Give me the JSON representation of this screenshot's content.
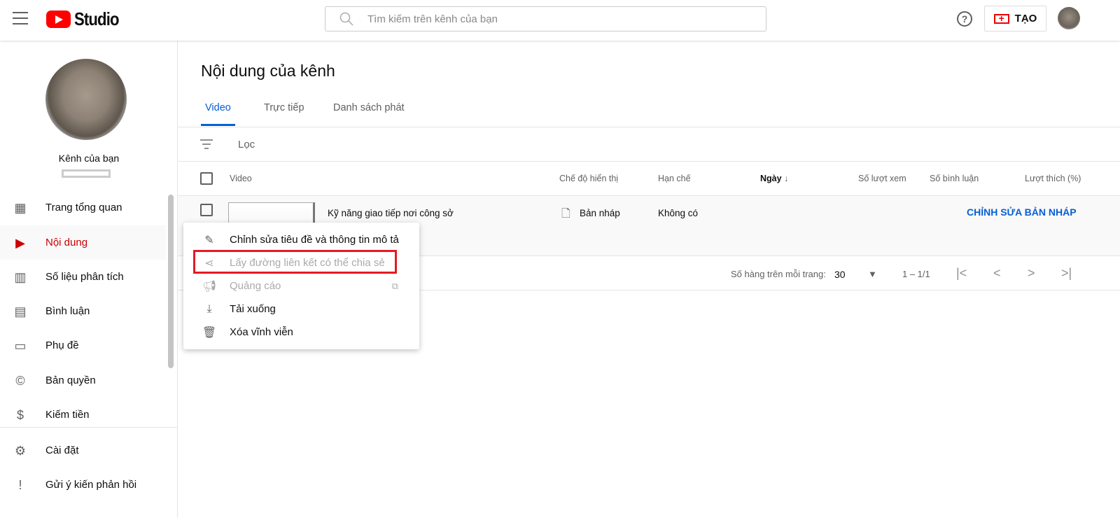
{
  "header": {
    "logo_text": "Studio",
    "search_placeholder": "Tìm kiếm trên kênh của bạn",
    "help": "?",
    "create_label": "TẠO"
  },
  "sidebar": {
    "channel_name": "Kênh của bạn",
    "items": [
      {
        "label": "Trang tổng quan",
        "icon": "dashboard-icon"
      },
      {
        "label": "Nội dung",
        "icon": "content-icon",
        "active": true
      },
      {
        "label": "Số liệu phân tích",
        "icon": "analytics-icon"
      },
      {
        "label": "Bình luận",
        "icon": "comments-icon"
      },
      {
        "label": "Phụ đề",
        "icon": "subtitles-icon"
      },
      {
        "label": "Bản quyền",
        "icon": "copyright-icon"
      },
      {
        "label": "Kiếm tiền",
        "icon": "dollar-icon"
      },
      {
        "label": "Cài đặt",
        "icon": "gear-icon"
      },
      {
        "label": "Gửi ý kiến phản hồi",
        "icon": "feedback-icon"
      }
    ]
  },
  "main": {
    "title": "Nội dung của kênh",
    "tabs": [
      "Video",
      "Trực tiếp",
      "Danh sách phát"
    ],
    "filter": "Lọc",
    "columns": [
      "Video",
      "Chế độ hiển thị",
      "Hạn chế",
      "Ngày",
      "Số lượt xem",
      "Số bình luận",
      "Lượt thích (%)"
    ],
    "row": {
      "title": "Kỹ năng giao tiếp nơi công sở",
      "visibility": "Bản nháp",
      "restriction": "Không có",
      "action": "CHỈNH SỬA BẢN NHÁP"
    },
    "pagination": {
      "rows_label": "Số hàng trên mỗi trang:",
      "rows_value": "30",
      "range": "1 – 1/1"
    }
  },
  "menu": {
    "items": [
      "Chỉnh sửa tiêu đề và thông tin mô tả",
      "Lấy đường liên kết có thể chia sẻ",
      "Quảng cáo",
      "Tải xuống",
      "Xóa vĩnh viễn"
    ]
  },
  "colors": {
    "accent": "#065fd4",
    "brand": "#ff0000",
    "highlight": "#e41b23"
  }
}
